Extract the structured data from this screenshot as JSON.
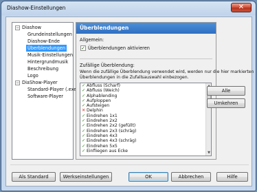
{
  "window": {
    "title": "Diashow-Einstellungen",
    "close_glyph": "✕"
  },
  "tree": {
    "groups": [
      {
        "label": "Diashow",
        "expander": "−",
        "items": [
          "Grundeinstellungen",
          "Diashow-Ende",
          "Überblendungen",
          "Musik-Einstellungen",
          "Hintergrundmusik",
          "Beschreibung",
          "Logo"
        ]
      },
      {
        "label": "DiaShow-Player",
        "expander": "−",
        "items": [
          "Standard-Player (.exe)",
          "Software-Player"
        ]
      }
    ],
    "selected": "Überblendungen"
  },
  "panel": {
    "header": "Überblendungen",
    "general_label": "Allgemein:",
    "enable_checkbox": {
      "label": "Überblendungen aktivieren",
      "checked": true,
      "mark": "✓"
    },
    "random_label": "Zufällige Überblendung:",
    "description": [
      "Wenn die zufällige Überblendung verwendet wird, werden nur die hier markierten",
      "Überblendungen in die Zufallsauswahl einbezogen."
    ],
    "transitions": [
      {
        "mark": "✓",
        "state": "on",
        "name": "Abfluss (Scharf)"
      },
      {
        "mark": "✓",
        "state": "on",
        "name": "Abfluss (Weich)"
      },
      {
        "mark": "✓",
        "state": "on",
        "name": "Alphablending"
      },
      {
        "mark": "✓",
        "state": "on",
        "name": "Aufploppen"
      },
      {
        "mark": "✓",
        "state": "on",
        "name": "Aufsteigen"
      },
      {
        "mark": "✕",
        "state": "off",
        "name": "Delphin"
      },
      {
        "mark": "✓",
        "state": "on",
        "name": "Eindrehen 1x1"
      },
      {
        "mark": "✓",
        "state": "on",
        "name": "Eindrehen 2x2"
      },
      {
        "mark": "✓",
        "state": "on",
        "name": "Eindrehen 2x2 (gefüllt)"
      },
      {
        "mark": "✓",
        "state": "on",
        "name": "Eindrehen 2x3 (schräg)"
      },
      {
        "mark": "✓",
        "state": "on",
        "name": "Eindrehen 4x3"
      },
      {
        "mark": "✓",
        "state": "on",
        "name": "Eindrehen 4x3 (schräg)"
      },
      {
        "mark": "✓",
        "state": "on",
        "name": "Eindrehen 5x5"
      },
      {
        "mark": "✓",
        "state": "on",
        "name": "Einfliegen aus Ecke"
      }
    ],
    "all_button": "Alle",
    "invert_button": "Umkehren",
    "scroll_up": "▲",
    "scroll_down": "▼"
  },
  "footer": {
    "standard_button": "Als Standard",
    "factory_button": "Werkseinstellungen",
    "ok_button": "OK",
    "cancel_button": "Abbrechen",
    "help_button": "Hilfe"
  }
}
